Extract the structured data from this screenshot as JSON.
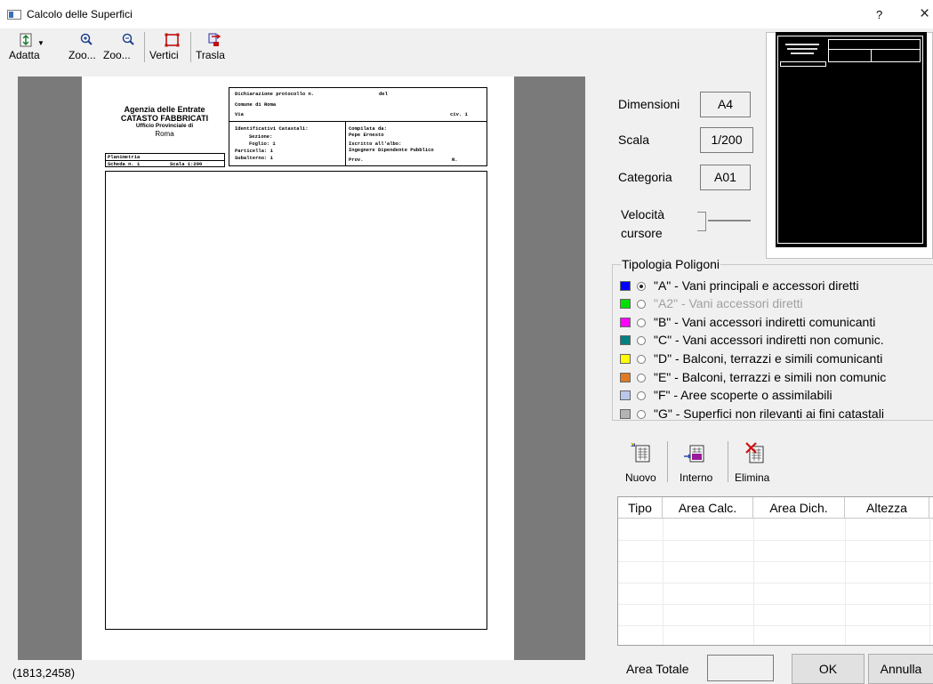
{
  "window": {
    "title": "Calcolo delle Superfici",
    "help_glyph": "?",
    "close_glyph": "×"
  },
  "toolbar": {
    "adapta": "Adatta",
    "zoom_in": "Zoo...",
    "zoom_out": "Zoo...",
    "vertici": "Vertici",
    "trasla": "Trasla"
  },
  "sheet": {
    "left_header": {
      "agency": "Agenzia delle Entrate",
      "cadastre": "CATASTO FABBRICATI",
      "office": "Ufficio Provinciale di",
      "city": "Roma"
    },
    "plan": {
      "title": "Planimetria",
      "sheet_no": "Scheda n. 1",
      "scale": "Scala 1:200"
    },
    "header_box": {
      "protocol": "Dichiarazione protocollo n.",
      "del": "del",
      "comune": "Comune di Roma",
      "via": "Via",
      "civ": "civ. 1",
      "ident": "Identificativi Catastali:",
      "sezione": "Sezione:",
      "foglio": "Foglio: 1",
      "particella": "Particella: 1",
      "subalterno": "Subalterno: 1",
      "compilata": "Compilata da:",
      "author": "Pepe Ernesto",
      "iscritto": "Iscritto all'albo:",
      "albo": "Ingegnere Dipendente Pubblico",
      "prov": "Prov.",
      "n": "N."
    }
  },
  "status": {
    "coords": "(1813,2458)"
  },
  "right_panel": {
    "dimensioni_label": "Dimensioni",
    "dimensioni_value": "A4",
    "scala_label": "Scala",
    "scala_value": "1/200",
    "categoria_label": "Categoria",
    "categoria_value": "A01",
    "velocita_label_1": "Velocità",
    "velocita_label_2": "cursore"
  },
  "polygon_types": {
    "title": "Tipologia Poligoni",
    "items": [
      {
        "label": "\"A\" - Vani principali e accessori diretti",
        "color": "#0000ff",
        "selected": true,
        "enabled": true
      },
      {
        "label": "\"A2\" - Vani accessori diretti",
        "color": "#00e000",
        "selected": false,
        "enabled": false
      },
      {
        "label": "\"B\" - Vani accessori indiretti comunicanti",
        "color": "#ff00ff",
        "selected": false,
        "enabled": true
      },
      {
        "label": "\"C\" - Vani accessori indiretti non comunic.",
        "color": "#008080",
        "selected": false,
        "enabled": true
      },
      {
        "label": "\"D\" - Balconi, terrazzi e simili comunicanti",
        "color": "#ffff00",
        "selected": false,
        "enabled": true
      },
      {
        "label": "\"E\" - Balconi, terrazzi e simili non comunic",
        "color": "#e07a20",
        "selected": false,
        "enabled": true
      },
      {
        "label": "\"F\" - Aree scoperte o assimilabili",
        "color": "#b8c8ec",
        "selected": false,
        "enabled": true
      },
      {
        "label": "\"G\" - Superfici non rilevanti ai fini catastali",
        "color": "#b4b4b4",
        "selected": false,
        "enabled": true
      }
    ]
  },
  "poly_actions": {
    "nuovo": "Nuovo",
    "interno": "Interno",
    "elimina": "Elimina"
  },
  "table": {
    "columns": [
      "Tipo",
      "Area Calc.",
      "Area Dich.",
      "Altezza"
    ]
  },
  "footer": {
    "area_totale_label": "Area Totale",
    "area_totale_value": "",
    "ok": "OK",
    "annulla": "Annulla"
  }
}
